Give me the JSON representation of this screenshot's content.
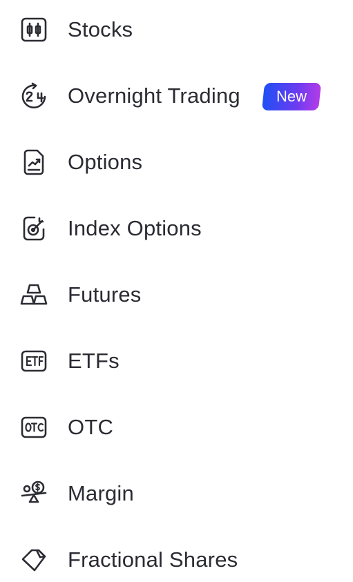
{
  "menu": {
    "items": [
      {
        "label": "Stocks",
        "icon": "candlestick-chart-icon"
      },
      {
        "label": "Overnight Trading",
        "icon": "clock-24h-icon",
        "badge": "New"
      },
      {
        "label": "Options",
        "icon": "document-chart-icon"
      },
      {
        "label": "Index Options",
        "icon": "target-arrow-icon"
      },
      {
        "label": "Futures",
        "icon": "stacked-bars-icon"
      },
      {
        "label": "ETFs",
        "icon": "etf-icon"
      },
      {
        "label": "OTC",
        "icon": "otc-icon"
      },
      {
        "label": "Margin",
        "icon": "balance-dollar-icon"
      },
      {
        "label": "Fractional Shares",
        "icon": "fraction-tag-icon"
      }
    ]
  },
  "colors": {
    "text": "#2b2b33",
    "icon_stroke": "#2b2b33",
    "badge_gradient_start": "#1f4ff5",
    "badge_gradient_end": "#b43be8",
    "background": "#ffffff"
  }
}
